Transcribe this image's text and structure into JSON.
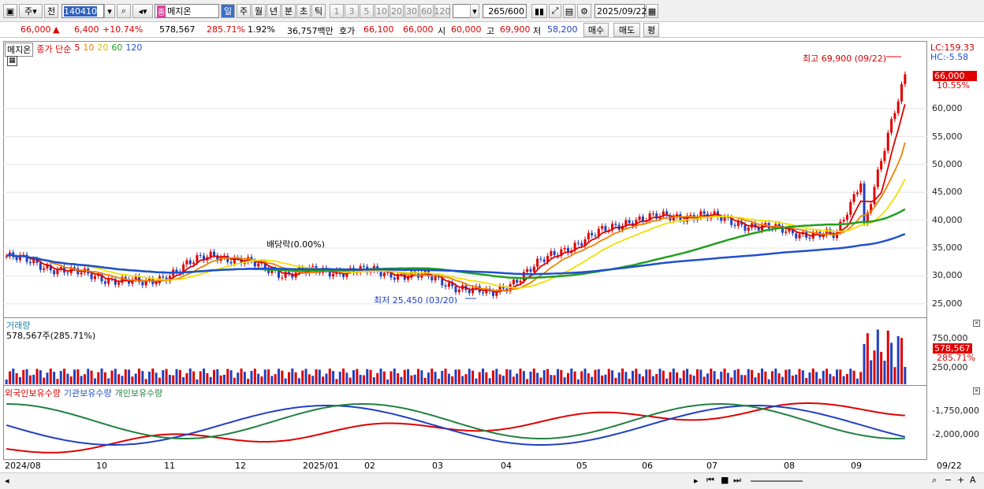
{
  "toolbar": {
    "period_type": "주",
    "prev_label": "전",
    "code": "140410",
    "name": "메지온",
    "period_tabs": [
      "일",
      "주",
      "월",
      "년",
      "분",
      "초",
      "틱"
    ],
    "interval_buttons": [
      "1",
      "3",
      "5",
      "10",
      "20",
      "30",
      "60",
      "120"
    ],
    "count_value": "265",
    "count_max": "/600",
    "date": "2025/09/22"
  },
  "quote": {
    "price": "66,000",
    "up_mark": "▲",
    "change": "6,400",
    "change_pct": "+10.74%",
    "volume": "578,567",
    "vol_ratio": "285.71%",
    "turnover": "1.92%",
    "amount": "36,757백만",
    "ask_label": "호가",
    "ask1": "66,100",
    "ask2": "66,000",
    "open_label": "시",
    "open": "60,000",
    "high_label": "고",
    "high": "69,900",
    "low_label": "저",
    "low": "58,200",
    "buy": "매수",
    "sell": "매도",
    "eval": "평"
  },
  "legend": {
    "name": "메지온",
    "close": "종가 단순",
    "ma": [
      {
        "label": "5",
        "color": "#e00000"
      },
      {
        "label": "10",
        "color": "#f08000"
      },
      {
        "label": "20",
        "color": "#f0e000"
      },
      {
        "label": "60",
        "color": "#20a020"
      },
      {
        "label": "120",
        "color": "#2050d0"
      }
    ]
  },
  "price_pane": {
    "lc": "LC:159.33",
    "hc": "HC:-5.58",
    "price_tag": "66,000",
    "pct_tag": "10.55%",
    "max_note": "최고 69,900 (09/22)",
    "min_note": "최저 25,450 (03/20)",
    "div_note": "배당락(0.00%)",
    "yticks": [
      "60,000",
      "55,000",
      "50,000",
      "45,000",
      "40,000",
      "35,000",
      "30,000",
      "25,000"
    ]
  },
  "volume_pane": {
    "title": "거래량",
    "value": "578,567주(285.71%)",
    "tag": "578,567",
    "tag_pct": "285.71%",
    "yticks": [
      "750,000",
      "500,000",
      "250,000"
    ]
  },
  "holding_pane": {
    "s1": "외국인보유수량",
    "s2": "기관보유수량",
    "s3": "개인보유수량",
    "yticks": [
      "-1,750,000",
      "-2,000,000"
    ]
  },
  "xaxis": [
    "2024/08",
    "10",
    "11",
    "12",
    "2025/01",
    "02",
    "03",
    "04",
    "05",
    "06",
    "07",
    "08",
    "09",
    "09/22"
  ],
  "colors": {
    "up": "#e00000",
    "down": "#2040c0"
  },
  "chart_data": {
    "type": "candlestick",
    "title": "메지온",
    "series": [
      {
        "name": "종가",
        "points": [
          [
            "2024/08",
            33500
          ],
          [
            "2024/09",
            30500
          ],
          [
            "2024/10",
            28500
          ],
          [
            "2024/11",
            34000
          ],
          [
            "2024/12",
            30500
          ],
          [
            "2025/01",
            31000
          ],
          [
            "2025/02",
            30000
          ],
          [
            "2025/03",
            26500
          ],
          [
            "2025/04",
            34500
          ],
          [
            "2025/05",
            40000
          ],
          [
            "2025/06",
            41000
          ],
          [
            "2025/07",
            38500
          ],
          [
            "2025/08",
            37000
          ],
          [
            "2025/09/22",
            66000
          ]
        ]
      },
      {
        "name": "5",
        "values_end": 59500
      },
      {
        "name": "10",
        "values_end": 56500
      },
      {
        "name": "20",
        "values_end": 51000
      },
      {
        "name": "60",
        "values_end": 42500
      },
      {
        "name": "120",
        "values_end": 40000
      }
    ],
    "ylim": [
      23000,
      71000
    ],
    "annotations": [
      {
        "text": "최고 69,900 (09/22)",
        "y": 69900
      },
      {
        "text": "최저 25,450 (03/20)",
        "y": 25450
      }
    ]
  }
}
